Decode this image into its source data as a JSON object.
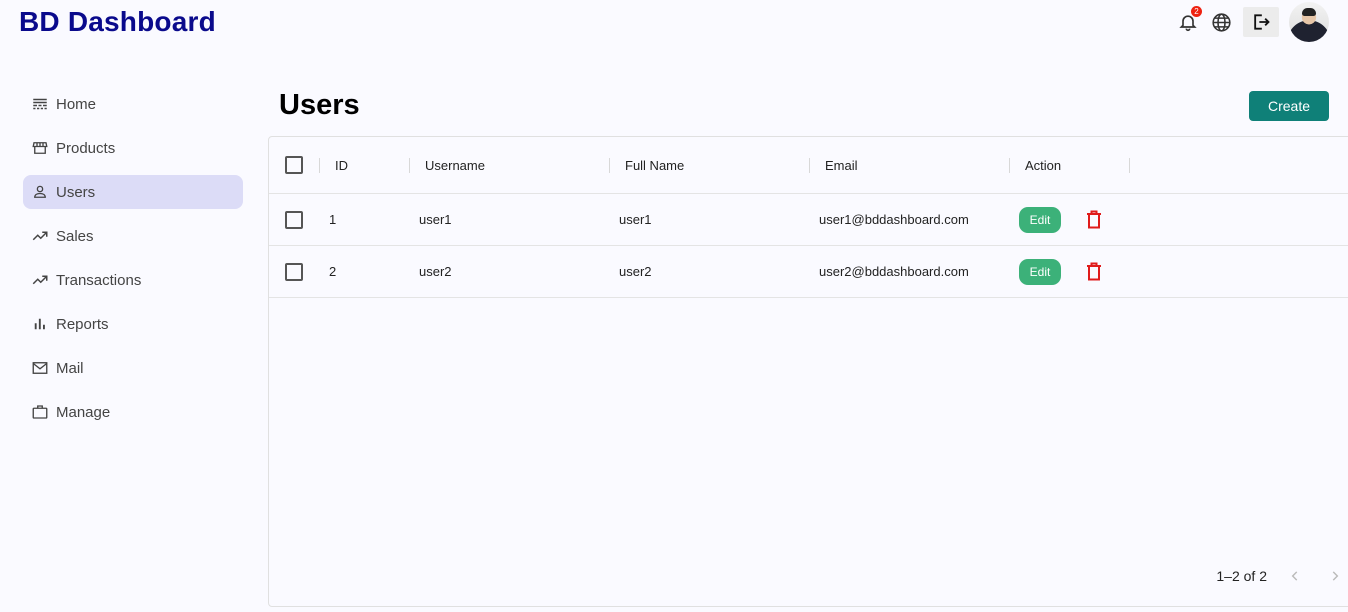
{
  "app": {
    "title": "BD Dashboard"
  },
  "header": {
    "notifications_count": "2",
    "icons": [
      "bell-icon",
      "globe-icon",
      "logout-icon",
      "avatar"
    ]
  },
  "sidebar": {
    "items": [
      {
        "label": "Home",
        "icon": "home-icon",
        "active": false
      },
      {
        "label": "Products",
        "icon": "store-icon",
        "active": false
      },
      {
        "label": "Users",
        "icon": "person-icon",
        "active": true
      },
      {
        "label": "Sales",
        "icon": "trending-up-icon",
        "active": false
      },
      {
        "label": "Transactions",
        "icon": "trending-up-icon",
        "active": false
      },
      {
        "label": "Reports",
        "icon": "bar-chart-icon",
        "active": false
      },
      {
        "label": "Mail",
        "icon": "mail-icon",
        "active": false
      },
      {
        "label": "Manage",
        "icon": "briefcase-icon",
        "active": false
      }
    ]
  },
  "main": {
    "title": "Users",
    "create_label": "Create",
    "table": {
      "columns": [
        "ID",
        "Username",
        "Full Name",
        "Email",
        "Action"
      ],
      "rows": [
        {
          "id": "1",
          "username": "user1",
          "full_name": "user1",
          "email": "user1@bddashboard.com",
          "edit_label": "Edit"
        },
        {
          "id": "2",
          "username": "user2",
          "full_name": "user2",
          "email": "user2@bddashboard.com",
          "edit_label": "Edit"
        }
      ]
    },
    "pagination": {
      "label": "1–2 of 2"
    }
  },
  "colors": {
    "brand": "#0a0a8c",
    "accent": "#0f8078",
    "edit": "#3cb179",
    "delete": "#e01b1b",
    "active_nav": "#dcdcf7"
  }
}
